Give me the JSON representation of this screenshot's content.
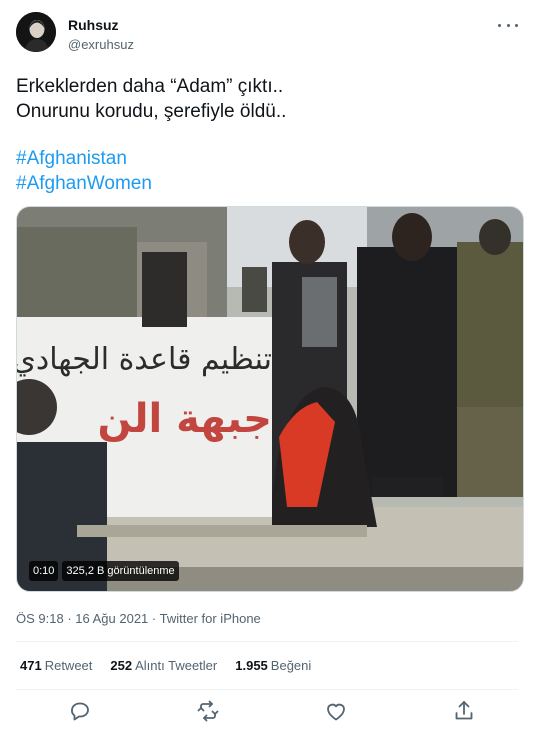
{
  "author": {
    "display_name": "Ruhsuz",
    "handle": "@exruhsuz",
    "avatar_icon": "person-avatar"
  },
  "menu_icon": "more-dots-icon",
  "tweet": {
    "lines": [
      "Erkeklerden daha “Adam” çıktı..",
      "Onurunu korudu, şerefiyle öldü.."
    ],
    "hashtags": [
      "#Afghanistan",
      "#AfghanWomen"
    ]
  },
  "media": {
    "duration": "0:10",
    "views": "325,2 B görüntülenme",
    "wall_text_1": "تنظيم قاعدة الجهادي",
    "wall_text_2": "جبهة الن"
  },
  "timestamp": {
    "time": "ÖS 9:18",
    "sep1": " · ",
    "date": "16 Ağu 2021",
    "sep2": " · ",
    "source": "Twitter for iPhone"
  },
  "stats": {
    "retweets_count": "471",
    "retweets_label": "Retweet",
    "quotes_count": "252",
    "quotes_label": "Alıntı Tweetler",
    "likes_count": "1.955",
    "likes_label": "Beğeni"
  },
  "actions": [
    "reply-icon",
    "retweet-icon",
    "like-icon",
    "share-icon"
  ],
  "colors": {
    "accent": "#1d9bf0",
    "text": "#0f1419",
    "muted": "#536471"
  }
}
